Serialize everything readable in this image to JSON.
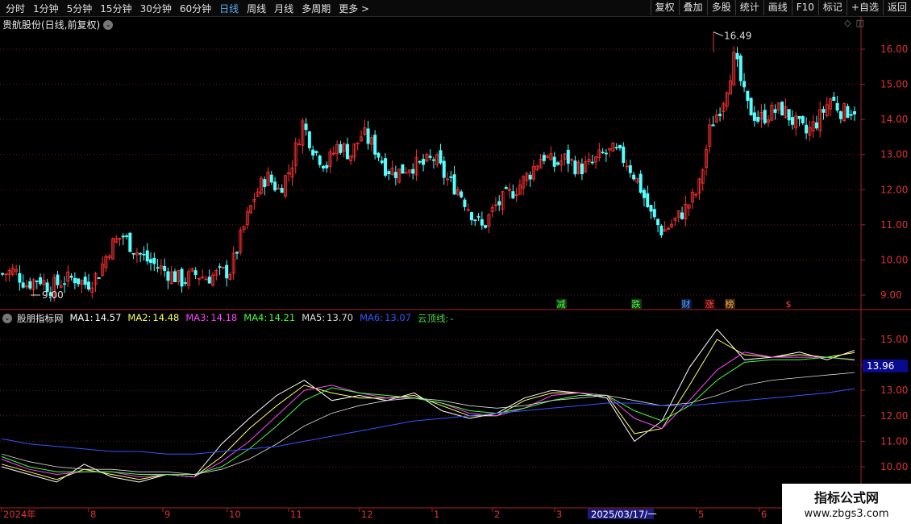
{
  "toolbar": {
    "periods": [
      {
        "label": "分时",
        "active": false
      },
      {
        "label": "1分钟",
        "active": false
      },
      {
        "label": "5分钟",
        "active": false
      },
      {
        "label": "15分钟",
        "active": false
      },
      {
        "label": "30分钟",
        "active": false
      },
      {
        "label": "60分钟",
        "active": false
      },
      {
        "label": "日线",
        "active": true
      },
      {
        "label": "周线",
        "active": false
      },
      {
        "label": "月线",
        "active": false
      },
      {
        "label": "多周期",
        "active": false
      },
      {
        "label": "更多 >",
        "active": false
      }
    ],
    "buttons": [
      "复权",
      "叠加",
      "多股",
      "统计",
      "画线",
      "F10",
      "标记",
      "+自选",
      "返回"
    ]
  },
  "stock": {
    "title": "贵航股份(日线,前复权)"
  },
  "price_axis": {
    "labels": [
      "16.00",
      "15.00",
      "14.00",
      "13.00",
      "12.00",
      "11.00",
      "10.00",
      "9.00"
    ],
    "high_label": "16.49",
    "low_label": "9.00"
  },
  "event_markers": [
    "减",
    "跌",
    "财",
    "涨",
    "榜",
    "$"
  ],
  "indicator": {
    "name": "股朋指标网",
    "items": [
      {
        "label": "MA1:",
        "value": "14.57",
        "color": "#ffffff"
      },
      {
        "label": "MA2:",
        "value": "14.48",
        "color": "#ffff66"
      },
      {
        "label": "MA3:",
        "value": "14.18",
        "color": "#ff44ff"
      },
      {
        "label": "MA4:",
        "value": "14.21",
        "color": "#44ff44"
      },
      {
        "label": "MA5:",
        "value": "13.70",
        "color": "#dddddd"
      },
      {
        "label": "MA6:",
        "value": "13.07",
        "color": "#3355ff"
      },
      {
        "label": "云顶线:",
        "value": "-",
        "color": "#44dd44"
      }
    ],
    "axis_labels": [
      "15.00",
      "14.00",
      "13.00",
      "12.00",
      "11.00",
      "10.00"
    ],
    "current_value": "13.96"
  },
  "time_axis": {
    "labels": [
      "2024年",
      "8",
      "9",
      "10",
      "11",
      "12",
      "1",
      "2",
      "3",
      "2025/03/17/一",
      "5",
      "6"
    ]
  },
  "watermark": {
    "title": "指标公式网",
    "url": "www.zbgs3.com"
  },
  "chart_data": {
    "type": "candlestick",
    "title": "贵航股份(日线,前复权)",
    "x_range": [
      "2024-07",
      "2025-06"
    ],
    "ylim": [
      8.7,
      16.7
    ],
    "highest": 16.49,
    "lowest": 9.0,
    "close_path": [
      9.6,
      9.7,
      9.3,
      9.5,
      9.2,
      9.4,
      9.5,
      9.3,
      9.6,
      10.4,
      10.7,
      10.3,
      10.0,
      9.8,
      9.6,
      9.4,
      9.6,
      9.5,
      9.6,
      9.7,
      10.8,
      11.8,
      12.4,
      12.0,
      12.6,
      13.9,
      13.1,
      12.7,
      13.3,
      13.0,
      13.6,
      13.2,
      12.6,
      12.5,
      12.7,
      12.7,
      12.9,
      12.3,
      12.0,
      11.4,
      10.9,
      11.5,
      11.8,
      12.1,
      12.5,
      13.0,
      12.7,
      12.9,
      12.6,
      12.7,
      13.0,
      13.1,
      12.8,
      12.2,
      11.3,
      10.8,
      11.1,
      11.5,
      12.0,
      13.8,
      14.5,
      15.8,
      14.4,
      14.0,
      14.2,
      14.3,
      13.9,
      13.6,
      14.0,
      14.6,
      14.2,
      14.3
    ],
    "moving_averages": {
      "MA1": [
        10.0,
        9.7,
        9.4,
        10.1,
        9.6,
        9.4,
        9.7,
        9.6,
        10.9,
        11.9,
        12.8,
        13.4,
        12.6,
        12.8,
        12.6,
        12.9,
        12.2,
        11.9,
        12.1,
        12.7,
        13.0,
        12.9,
        12.7,
        11.0,
        11.8,
        13.9,
        15.4,
        14.2,
        14.3,
        14.5,
        14.2,
        14.57
      ],
      "MA2": [
        10.1,
        9.8,
        9.5,
        9.9,
        9.7,
        9.5,
        9.7,
        9.6,
        10.4,
        11.5,
        12.4,
        13.2,
        12.9,
        12.7,
        12.7,
        12.8,
        12.4,
        12.0,
        12.0,
        12.6,
        12.9,
        12.9,
        12.8,
        11.3,
        11.5,
        13.2,
        15.0,
        14.4,
        14.3,
        14.4,
        14.3,
        14.48
      ],
      "MA3": [
        10.3,
        9.9,
        9.7,
        9.8,
        9.8,
        9.6,
        9.7,
        9.6,
        10.2,
        11.0,
        12.0,
        13.0,
        13.2,
        12.9,
        12.7,
        12.7,
        12.5,
        12.1,
        12.0,
        12.3,
        12.8,
        12.9,
        12.8,
        11.9,
        11.5,
        12.6,
        13.8,
        14.5,
        14.3,
        14.3,
        14.3,
        14.18
      ],
      "MA4": [
        10.4,
        10.0,
        9.8,
        9.8,
        9.8,
        9.7,
        9.7,
        9.7,
        10.0,
        10.7,
        11.6,
        12.6,
        13.1,
        12.9,
        12.8,
        12.7,
        12.5,
        12.2,
        12.1,
        12.3,
        12.6,
        12.8,
        12.8,
        12.2,
        11.8,
        12.4,
        13.4,
        14.1,
        14.2,
        14.2,
        14.3,
        14.21
      ],
      "MA5": [
        10.5,
        10.2,
        10.0,
        9.9,
        9.9,
        9.8,
        9.8,
        9.7,
        9.9,
        10.3,
        10.9,
        11.6,
        12.1,
        12.4,
        12.6,
        12.7,
        12.6,
        12.4,
        12.3,
        12.4,
        12.6,
        12.7,
        12.8,
        12.6,
        12.4,
        12.5,
        12.8,
        13.2,
        13.4,
        13.5,
        13.6,
        13.7
      ],
      "MA6": [
        11.1,
        10.9,
        10.8,
        10.7,
        10.6,
        10.6,
        10.5,
        10.5,
        10.6,
        10.7,
        10.8,
        11.0,
        11.2,
        11.4,
        11.6,
        11.8,
        11.9,
        12.0,
        12.1,
        12.2,
        12.3,
        12.4,
        12.5,
        12.5,
        12.4,
        12.4,
        12.5,
        12.6,
        12.7,
        12.8,
        12.9,
        13.07
      ]
    },
    "indicator_ylim": [
      9.5,
      15.7
    ],
    "indicator_current": 13.96
  }
}
